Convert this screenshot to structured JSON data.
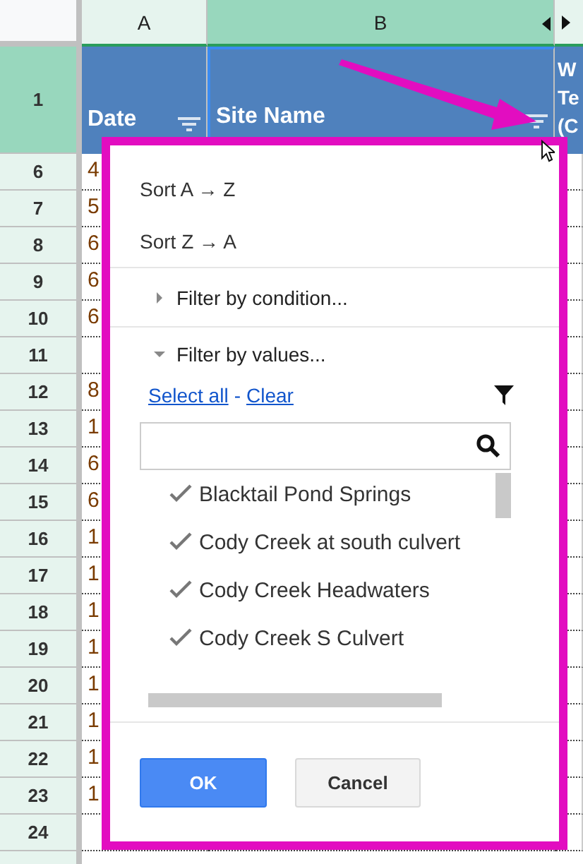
{
  "sheet": {
    "columns": [
      {
        "label": "A",
        "selected": false
      },
      {
        "label": "B",
        "selected": true
      }
    ],
    "header_row": {
      "number": "1",
      "cells": [
        "Date",
        "Site Name"
      ],
      "column_3_lines": [
        "W",
        "Te",
        "(C"
      ]
    },
    "rows": [
      {
        "number": "6",
        "column_a": "4"
      },
      {
        "number": "7",
        "column_a": "5"
      },
      {
        "number": "8",
        "column_a": "6"
      },
      {
        "number": "9",
        "column_a": "6"
      },
      {
        "number": "10",
        "column_a": "6"
      },
      {
        "number": "11",
        "column_a": ""
      },
      {
        "number": "12",
        "column_a": "8"
      },
      {
        "number": "13",
        "column_a": "1"
      },
      {
        "number": "14",
        "column_a": "6"
      },
      {
        "number": "15",
        "column_a": "6"
      },
      {
        "number": "16",
        "column_a": "1"
      },
      {
        "number": "17",
        "column_a": "1"
      },
      {
        "number": "18",
        "column_a": "1"
      },
      {
        "number": "19",
        "column_a": "1"
      },
      {
        "number": "20",
        "column_a": "1"
      },
      {
        "number": "21",
        "column_a": "1"
      },
      {
        "number": "22",
        "column_a": "1"
      },
      {
        "number": "23",
        "column_a": "1"
      },
      {
        "number": "24",
        "column_a": ""
      }
    ]
  },
  "filter_menu": {
    "sort": [
      "Sort A → Z",
      "Sort Z → A"
    ],
    "sections": [
      {
        "label": "Filter by condition...",
        "expanded": false
      },
      {
        "label": "Filter by values...",
        "expanded": true
      }
    ],
    "select_all": "Select all",
    "separator": "-",
    "clear": "Clear",
    "values": [
      {
        "label": "Blacktail Pond Springs",
        "checked": true
      },
      {
        "label": "Cody Creek at south culvert",
        "checked": true
      },
      {
        "label": "Cody Creek Headwaters",
        "checked": true
      },
      {
        "label": "Cody Creek S Culvert",
        "checked": true
      }
    ],
    "buttons": [
      {
        "label": "OK",
        "kind": "primary"
      },
      {
        "label": "Cancel",
        "kind": "secondary"
      }
    ]
  }
}
